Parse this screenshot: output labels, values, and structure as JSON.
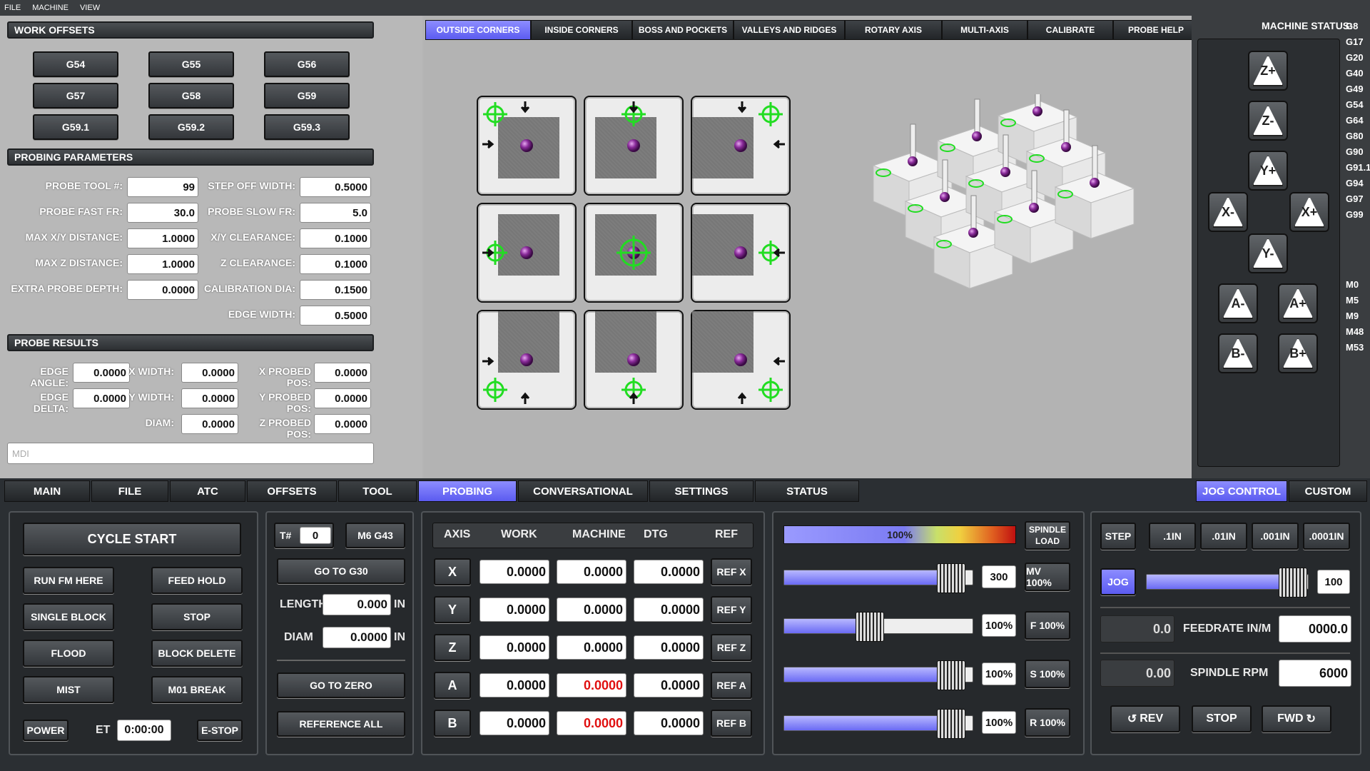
{
  "menubar": {
    "items": [
      "FILE",
      "MACHINE",
      "VIEW"
    ]
  },
  "work_offsets": {
    "title": "WORK OFFSETS",
    "buttons": [
      "G54",
      "G55",
      "G56",
      "G57",
      "G58",
      "G59",
      "G59.1",
      "G59.2",
      "G59.3"
    ]
  },
  "probing_params": {
    "title": "PROBING PARAMETERS",
    "left": [
      {
        "label": "PROBE TOOL #:",
        "value": "99"
      },
      {
        "label": "PROBE FAST FR:",
        "value": "30.0"
      },
      {
        "label": "MAX X/Y DISTANCE:",
        "value": "1.0000"
      },
      {
        "label": "MAX Z DISTANCE:",
        "value": "1.0000"
      },
      {
        "label": "EXTRA PROBE DEPTH:",
        "value": "0.0000"
      }
    ],
    "right": [
      {
        "label": "STEP OFF WIDTH:",
        "value": "0.5000"
      },
      {
        "label": "PROBE SLOW FR:",
        "value": "5.0"
      },
      {
        "label": "X/Y CLEARANCE:",
        "value": "0.1000"
      },
      {
        "label": "Z CLEARANCE:",
        "value": "0.1000"
      },
      {
        "label": "CALIBRATION DIA:",
        "value": "0.1500"
      },
      {
        "label": "EDGE WIDTH:",
        "value": "0.5000"
      }
    ]
  },
  "probe_results": {
    "title": "PROBE RESULTS",
    "col1": [
      {
        "label": "EDGE ANGLE:",
        "value": "0.0000"
      },
      {
        "label": "EDGE DELTA:",
        "value": "0.0000"
      }
    ],
    "col2": [
      {
        "label": "X WIDTH:",
        "value": "0.0000"
      },
      {
        "label": "Y WIDTH:",
        "value": "0.0000"
      },
      {
        "label": "DIAM:",
        "value": "0.0000"
      }
    ],
    "col3": [
      {
        "label": "X PROBED POS:",
        "value": "0.0000"
      },
      {
        "label": "Y PROBED POS:",
        "value": "0.0000"
      },
      {
        "label": "Z PROBED POS:",
        "value": "0.0000"
      }
    ]
  },
  "mdi": {
    "placeholder": "MDI"
  },
  "probe_tabs": [
    "OUTSIDE CORNERS",
    "INSIDE CORNERS",
    "BOSS AND POCKETS",
    "VALLEYS AND RIDGES",
    "ROTARY AXIS",
    "MULTI-AXIS",
    "CALIBRATE",
    "PROBE HELP"
  ],
  "machine_status": {
    "title": "MACHINE STATUS:",
    "gcodes": [
      "G8",
      "G17",
      "G20",
      "G40",
      "G49",
      "G54",
      "G64",
      "G80",
      "G90",
      "G91.1",
      "G94",
      "G97",
      "G99"
    ],
    "mcodes": [
      "M0",
      "M5",
      "M9",
      "M48",
      "M53"
    ]
  },
  "jog_buttons": [
    "Z+",
    "Z-",
    "Y+",
    "X-",
    "X+",
    "Y-",
    "A-",
    "A+",
    "B-",
    "B+"
  ],
  "main_tabs": [
    "MAIN",
    "FILE",
    "ATC",
    "OFFSETS",
    "TOOL",
    "PROBING",
    "CONVERSATIONAL",
    "SETTINGS",
    "STATUS"
  ],
  "right_tabs": [
    "JOG CONTROL",
    "CUSTOM"
  ],
  "cycle": {
    "cycle_start": "CYCLE START",
    "buttons": [
      "RUN FM HERE",
      "FEED HOLD",
      "SINGLE BLOCK",
      "STOP",
      "FLOOD",
      "BLOCK DELETE",
      "MIST",
      "M01 BREAK"
    ],
    "power": "POWER",
    "et_label": "ET",
    "et_value": "0:00:00",
    "estop": "E-STOP"
  },
  "tool": {
    "t_label": "T#",
    "t_value": "0",
    "m6": "M6 G43",
    "g30": "GO TO G30",
    "length_label": "LENGTH",
    "length_value": "0.000",
    "length_unit": "IN",
    "diam_label": "DIAM",
    "diam_value": "0.0000",
    "diam_unit": "IN",
    "go_zero": "GO TO ZERO",
    "ref_all": "REFERENCE ALL"
  },
  "dro": {
    "headers": [
      "AXIS",
      "WORK",
      "MACHINE",
      "DTG",
      "REF"
    ],
    "rows": [
      {
        "axis": "X",
        "work": "0.0000",
        "machine": "0.0000",
        "dtg": "0.0000",
        "ref": "REF X",
        "red": false
      },
      {
        "axis": "Y",
        "work": "0.0000",
        "machine": "0.0000",
        "dtg": "0.0000",
        "ref": "REF Y",
        "red": false
      },
      {
        "axis": "Z",
        "work": "0.0000",
        "machine": "0.0000",
        "dtg": "0.0000",
        "ref": "REF Z",
        "red": false
      },
      {
        "axis": "A",
        "work": "0.0000",
        "machine": "0.0000",
        "dtg": "0.0000",
        "ref": "REF A",
        "red": true
      },
      {
        "axis": "B",
        "work": "0.0000",
        "machine": "0.0000",
        "dtg": "0.0000",
        "ref": "REF B",
        "red": true
      }
    ]
  },
  "overrides": {
    "spindle_load_pct": "100%",
    "spindle_load_label": "SPINDLE LOAD",
    "rows": [
      {
        "value": "300",
        "button": "MV 100%",
        "level": 0.88
      },
      {
        "value": "100%",
        "button": "F 100%",
        "level": 0.45
      },
      {
        "value": "100%",
        "button": "S 100%",
        "level": 0.88
      },
      {
        "value": "100%",
        "button": "R 100%",
        "level": 0.88
      }
    ]
  },
  "jog_control": {
    "step": "STEP",
    "increments": [
      ".1IN",
      ".01IN",
      ".001IN",
      ".0001IN"
    ],
    "jog": "JOG",
    "jog_value": "100",
    "jog_level": 0.9,
    "feed_actual": "0.0",
    "feed_label": "FEEDRATE IN/M",
    "feed_set": "0000.0",
    "rpm_actual": "0.00",
    "rpm_label": "SPINDLE RPM",
    "rpm_set": "6000",
    "rev": "REV",
    "stop": "STOP",
    "fwd": "FWD"
  },
  "colors": {
    "accent": "#6a6af4",
    "green_target": "#22dd22",
    "ball": "#8a2b9a"
  }
}
